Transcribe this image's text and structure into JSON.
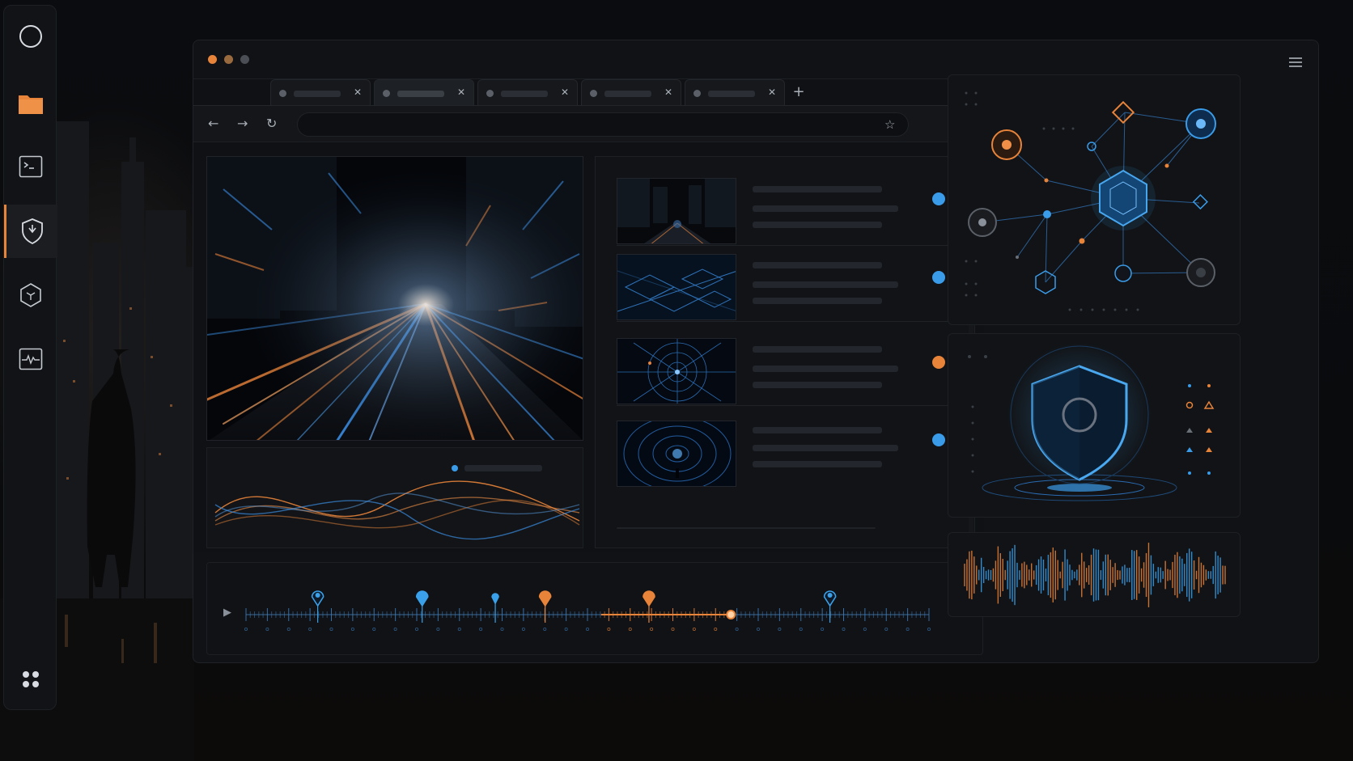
{
  "window": {
    "traffic_colors": [
      "#e8833a",
      "#9a6a3f",
      "#4b4f55"
    ]
  },
  "dock": {
    "items": [
      {
        "name": "circle-icon",
        "active": false
      },
      {
        "name": "folder-icon",
        "active": false
      },
      {
        "name": "terminal-icon",
        "active": false
      },
      {
        "name": "shield-icon",
        "active": true
      },
      {
        "name": "hexagon-cube-icon",
        "active": false
      },
      {
        "name": "activity-monitor-icon",
        "active": false
      },
      {
        "name": "apps-grid-icon",
        "active": false
      }
    ],
    "accent": "#e8833a"
  },
  "browser": {
    "tabs": [
      {
        "active": false,
        "close": "✕"
      },
      {
        "active": true,
        "close": "✕"
      },
      {
        "active": false,
        "close": "✕"
      },
      {
        "active": false,
        "close": "✕"
      },
      {
        "active": false,
        "close": "✕"
      }
    ],
    "new_tab": "+",
    "back": "←",
    "forward": "→",
    "reload": "↻",
    "bookmark": "☆",
    "more": "⋮"
  },
  "feed": {
    "items": [
      {
        "thumb": "city-street",
        "status_color": "#3a9be8"
      },
      {
        "thumb": "blueprint-cubes",
        "status_color": "#3a9be8"
      },
      {
        "thumb": "radar-grid",
        "status_color": "#e8833a"
      },
      {
        "thumb": "tunnel-figure",
        "status_color": "#3a9be8"
      }
    ]
  },
  "timeline": {
    "play": "▶",
    "markers": [
      {
        "pos": 0.105,
        "color": "#3aa0ea",
        "style": "ring"
      },
      {
        "pos": 0.258,
        "color": "#3aa0ea",
        "style": "filled"
      },
      {
        "pos": 0.365,
        "color": "#3aa0ea",
        "style": "small"
      },
      {
        "pos": 0.438,
        "color": "#e8833a",
        "style": "filled"
      },
      {
        "pos": 0.59,
        "color": "#e8833a",
        "style": "filled"
      },
      {
        "pos": 0.855,
        "color": "#3aa0ea",
        "style": "ring"
      }
    ],
    "playhead": 0.71
  },
  "colors": {
    "blue": "#3aa0ea",
    "orange": "#e8833a"
  }
}
